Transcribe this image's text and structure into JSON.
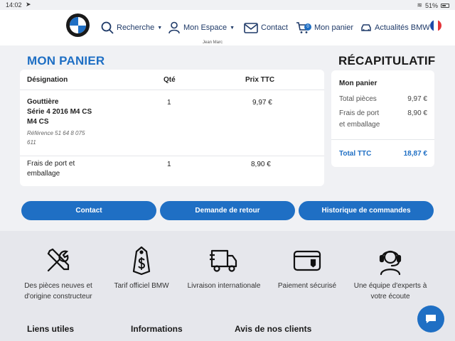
{
  "status_bar": {
    "time": "14:02",
    "battery": "51%"
  },
  "header": {
    "nav": {
      "recherche": "Recherche",
      "espace": "Mon Espace",
      "espace_user": "Jean Marc",
      "contact": "Contact",
      "panier": "Mon panier",
      "panier_count": "0",
      "actus": "Actualités BMW"
    },
    "flag_colors": [
      "#1f4aa8",
      "#ffffff",
      "#e4353a"
    ]
  },
  "cart": {
    "heading": "MON PANIER",
    "columns": {
      "designation": "Désignation",
      "qty": "Qté",
      "price": "Prix TTC"
    },
    "rows": [
      {
        "line1": "Gouttière",
        "line2": "Série 4 2016 M4 CS",
        "line3": "M4 CS",
        "ref1": "Référence 51 64 8 075",
        "ref2": "611",
        "qty": "1",
        "price": "9,97 €"
      },
      {
        "line1": "Frais de port et",
        "line2": "emballage",
        "qty": "1",
        "price": "8,90 €"
      }
    ]
  },
  "recap": {
    "heading": "RÉCAPITULATIF",
    "title": "Mon panier",
    "total_pieces_label": "Total pièces",
    "total_pieces_value": "9,97 €",
    "frais_label_1": "Frais de port",
    "frais_label_2": "et emballage",
    "frais_value": "8,90 €",
    "total_label": "Total TTC",
    "total_value": "18,87 €"
  },
  "buttons": {
    "contact": "Contact",
    "retour": "Demande de retour",
    "historique": "Historique de commandes"
  },
  "features": [
    {
      "icon": "tools-icon",
      "line1": "Des pièces neuves et",
      "line2": "d'origine constructeur"
    },
    {
      "icon": "price-tag-icon",
      "line1": "Tarif officiel BMW",
      "line2": ""
    },
    {
      "icon": "truck-icon",
      "line1": "Livraison internationale",
      "line2": ""
    },
    {
      "icon": "card-icon",
      "line1": "Paiement sécurisé",
      "line2": ""
    },
    {
      "icon": "headset-icon",
      "line1": "Une équipe d'experts à",
      "line2": "votre écoute"
    }
  ],
  "footer": {
    "liens": "Liens utiles",
    "infos": "Informations",
    "avis": "Avis de nos clients"
  },
  "colors": {
    "accent": "#1f6fc4",
    "nav": "#1f3a68",
    "background": "#f0f1f4"
  }
}
